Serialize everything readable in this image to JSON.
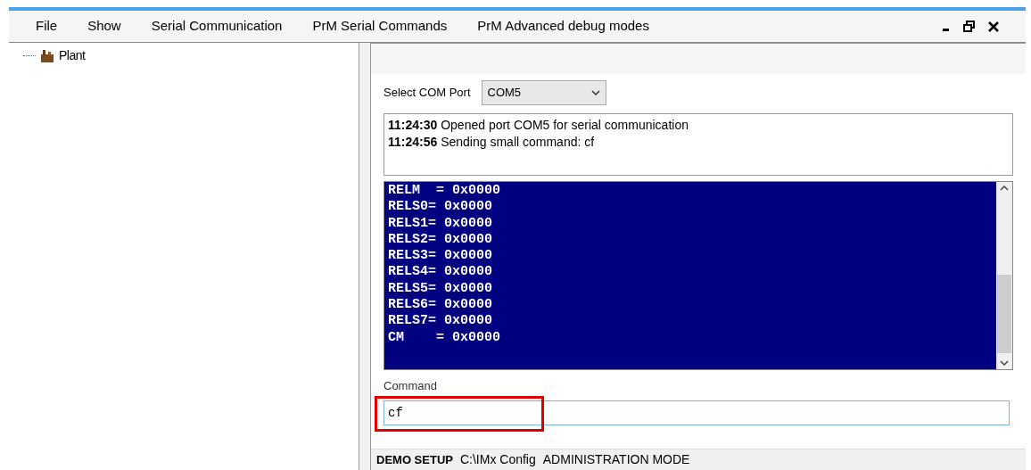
{
  "menu": [
    "File",
    "Show",
    "Serial Communication",
    "PrM Serial Commands",
    "PrM Advanced debug modes"
  ],
  "tree": [
    {
      "label": "Plant"
    }
  ],
  "com_port": {
    "label": "Select COM Port",
    "value": "COM5"
  },
  "log": [
    "**11:24:30** Opened port COM5 for serial communication",
    "**11:24:56** Sending small command: cf"
  ],
  "console": [
    "RELM  = 0x0000",
    "RELS0= 0x0000",
    "RELS1= 0x0000",
    "RELS2= 0x0000",
    "RELS3= 0x0000",
    "RELS4= 0x0000",
    "RELS5= 0x0000",
    "RELS6= 0x0000",
    "RELS7= 0x0000",
    "CM    = 0x0000"
  ],
  "command": {
    "label": "Command",
    "value": "cf"
  },
  "status_bar": {
    "setup": "DEMO SETUP",
    "path": "C:\\IMx Config",
    "mode": "ADMINISTRATION MODE"
  }
}
